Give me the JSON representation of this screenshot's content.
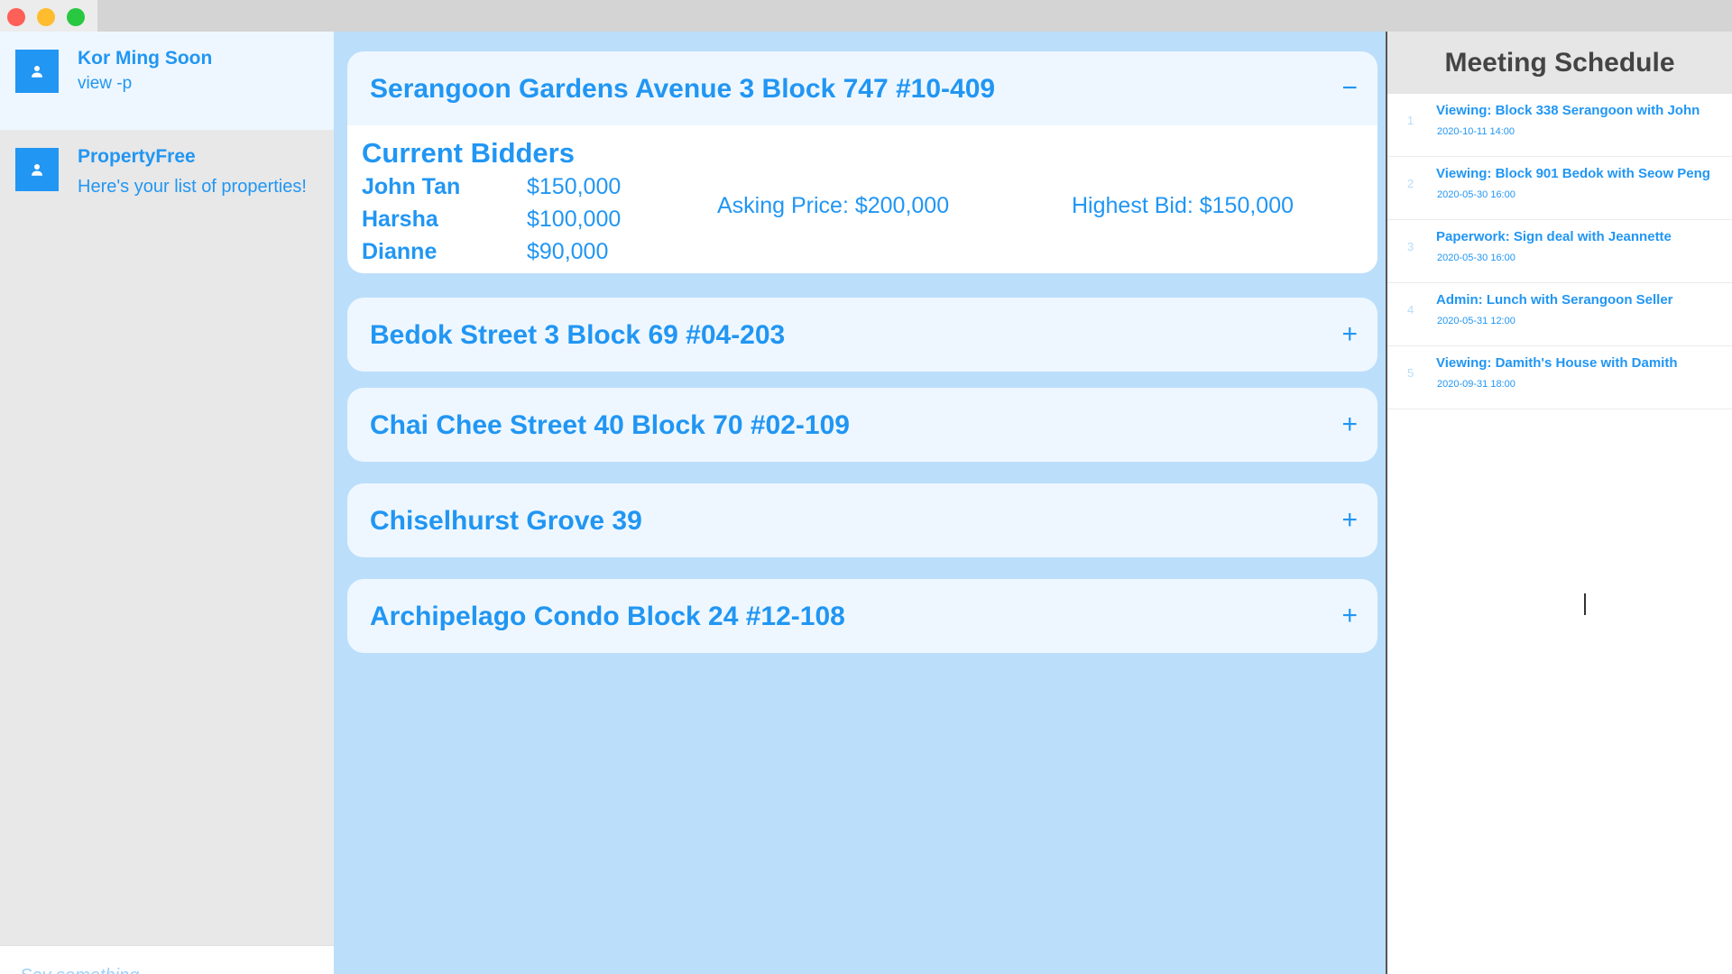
{
  "window": {
    "buttons": [
      "close",
      "minimize",
      "maximize"
    ]
  },
  "chat": {
    "messages": [
      {
        "name": "Kor Ming Soon",
        "text": "view -p",
        "icon": "person-icon"
      },
      {
        "name": "PropertyFree",
        "text": "Here's your list of properties!",
        "icon": "person-icon"
      }
    ],
    "input": {
      "placeholder": "Say something...",
      "value": ""
    },
    "send_icon": "arrow-right-icon"
  },
  "properties": [
    {
      "title": "Serangoon Gardens Avenue 3 Block 747 #10-409",
      "toggle": "−",
      "expanded": true,
      "bidders_title": "Current Bidders",
      "bidders": [
        {
          "name": "John Tan",
          "amount": "$150,000"
        },
        {
          "name": "Harsha",
          "amount": "$100,000"
        },
        {
          "name": "Dianne",
          "amount": "$90,000"
        }
      ],
      "asking_price": "Asking Price: $200,000",
      "highest_bid": "Highest Bid: $150,000"
    },
    {
      "title": "Bedok Street 3 Block 69 #04-203",
      "toggle": "+"
    },
    {
      "title": "Chai Chee Street 40 Block 70 #02-109",
      "toggle": "+"
    },
    {
      "title": "Chiselhurst Grove 39",
      "toggle": "+"
    },
    {
      "title": "Archipelago Condo Block 24 #12-108",
      "toggle": "+"
    }
  ],
  "schedule": {
    "title": "Meeting Schedule",
    "items": [
      {
        "num": "1",
        "title": "Viewing: Block 338 Serangoon with John",
        "time": "2020-10-11 14:00"
      },
      {
        "num": "2",
        "title": "Viewing: Block 901 Bedok with Seow Peng",
        "time": "2020-05-30 16:00"
      },
      {
        "num": "3",
        "title": "Paperwork: Sign deal with Jeannette",
        "time": "2020-05-30 16:00"
      },
      {
        "num": "4",
        "title": "Admin: Lunch with Serangoon Seller",
        "time": "2020-05-31 12:00"
      },
      {
        "num": "5",
        "title": "Viewing: Damith's House with Damith",
        "time": "2020-09-31 18:00"
      }
    ]
  },
  "colors": {
    "accent": "#2196f3",
    "main_bg": "#bbdefb",
    "card_bg": "#eef7ff",
    "sidebar_bg": "#e8e8e8"
  }
}
